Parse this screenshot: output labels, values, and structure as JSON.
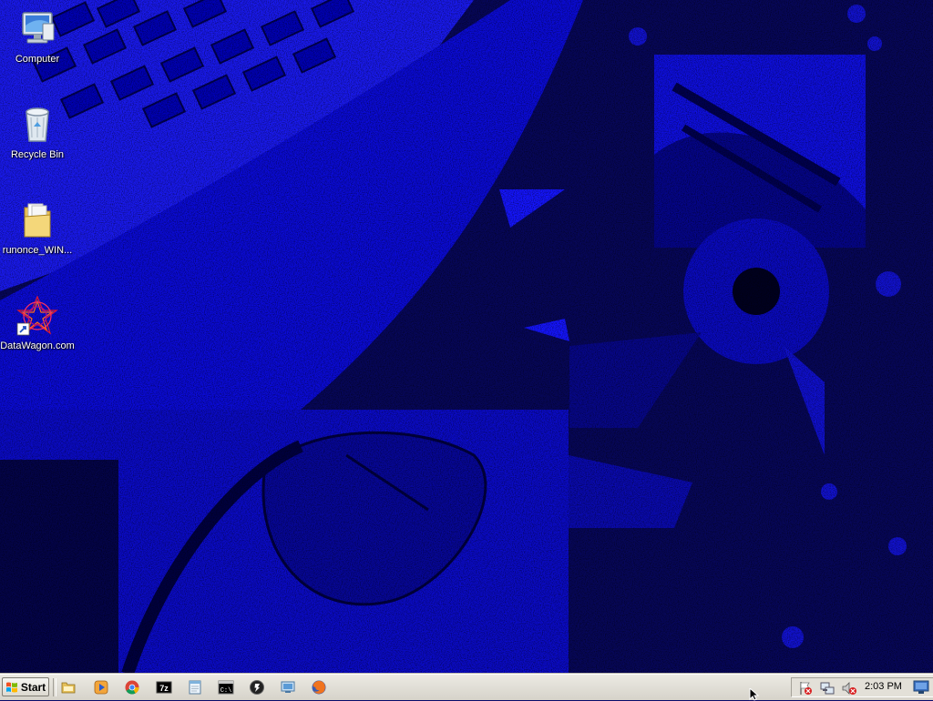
{
  "desktop": {
    "icons": [
      {
        "label": "Computer",
        "icon": "computer-icon"
      },
      {
        "label": "Recycle Bin",
        "icon": "recycle-bin-icon"
      },
      {
        "label": "runonce_WIN...",
        "icon": "folder-icon"
      },
      {
        "label": "DataWagon.com",
        "icon": "datawagon-shortcut-icon"
      }
    ]
  },
  "taskbar": {
    "start_label": "Start",
    "quick_launch": [
      {
        "icon": "file-explorer-icon"
      },
      {
        "icon": "media-player-icon"
      },
      {
        "icon": "chrome-icon"
      },
      {
        "icon": "7zip-icon",
        "text": "7z"
      },
      {
        "icon": "notepad-icon"
      },
      {
        "icon": "command-prompt-icon",
        "text": "C:\\"
      },
      {
        "icon": "app-icon"
      },
      {
        "icon": "remote-desktop-icon"
      },
      {
        "icon": "firefox-icon"
      }
    ],
    "tray": {
      "icons": [
        "action-center-flag-icon",
        "network-icon",
        "volume-muted-icon"
      ],
      "clock": "2:03 PM"
    }
  },
  "colors": {
    "wallpaper_blue": "#0a0aff",
    "wallpaper_dark": "#000000",
    "taskbar_bg": "#e4e1d9"
  }
}
